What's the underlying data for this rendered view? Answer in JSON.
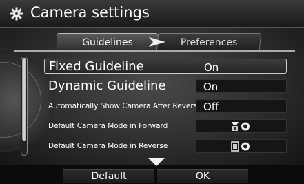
{
  "header": {
    "title": "Camera settings",
    "icon": "gear-icon"
  },
  "tabs": [
    {
      "label": "Guidelines",
      "active": true
    },
    {
      "label": "Preferences",
      "active": false
    }
  ],
  "rows": [
    {
      "label": "Fixed Guideline",
      "value": "On"
    },
    {
      "label": "Dynamic Guideline",
      "value": "On"
    },
    {
      "label": "Automatically Show Camera After Reverse",
      "value": "Off"
    },
    {
      "label": "Default Camera Mode in Forward",
      "value_icon": "camera-mode-icon"
    },
    {
      "label": "Default Camera Mode in Reverse",
      "value_icon": "camera-mode-icon"
    }
  ],
  "footer": {
    "default_label": "Default",
    "ok_label": "OK"
  }
}
